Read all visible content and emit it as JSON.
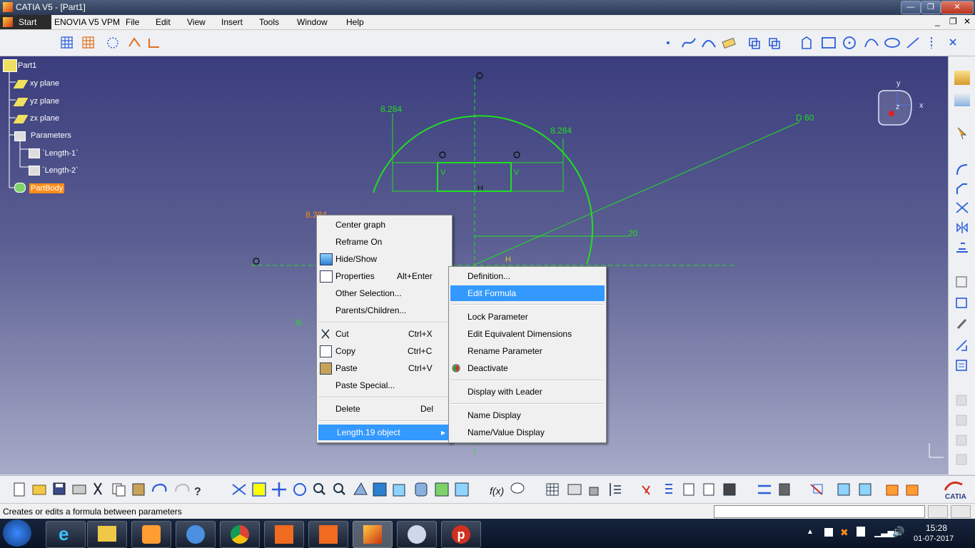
{
  "window": {
    "title": "CATIA V5 - [Part1]"
  },
  "menubar": {
    "items": [
      "Start",
      "ENOVIA V5 VPM",
      "File",
      "Edit",
      "View",
      "Insert",
      "Tools",
      "Window",
      "Help"
    ]
  },
  "tree": {
    "root": "Part1",
    "items": [
      "xy plane",
      "yz plane",
      "zx plane",
      "Parameters",
      "`Length-1`",
      "`Length-2`",
      "PartBody"
    ]
  },
  "sketch": {
    "dim_top_left": "8.284",
    "dim_top_right": "8.284",
    "dim_diameter": "D 60",
    "dim_left": "8.284",
    "dim_right": "20",
    "dim_partial": "8.",
    "label_v1": "V",
    "label_v2": "V",
    "label_h_top": "H",
    "label_h_mid": "H"
  },
  "axis": {
    "x": "x",
    "y": "y",
    "z": "z"
  },
  "context_menu": {
    "items": [
      {
        "label": "Center graph",
        "shortcut": ""
      },
      {
        "label": "Reframe On",
        "shortcut": ""
      },
      {
        "label": "Hide/Show",
        "shortcut": ""
      },
      {
        "label": "Properties",
        "shortcut": "Alt+Enter"
      },
      {
        "label": "Other Selection...",
        "shortcut": ""
      },
      {
        "label": "Parents/Children...",
        "shortcut": ""
      },
      {
        "label": "Cut",
        "shortcut": "Ctrl+X"
      },
      {
        "label": "Copy",
        "shortcut": "Ctrl+C"
      },
      {
        "label": "Paste",
        "shortcut": "Ctrl+V"
      },
      {
        "label": "Paste Special...",
        "shortcut": ""
      },
      {
        "label": "Delete",
        "shortcut": "Del"
      },
      {
        "label": "Length.19 object",
        "shortcut": ""
      }
    ]
  },
  "submenu": {
    "items": [
      "Definition...",
      "Edit Formula",
      "Lock Parameter",
      "Edit Equivalent Dimensions",
      "Rename Parameter",
      "Deactivate",
      "Display with Leader",
      "Name Display",
      "Name/Value Display"
    ]
  },
  "status": {
    "text": "Creates or edits a formula between parameters"
  },
  "taskbar": {
    "time": "15:28",
    "date": "01-07-2017"
  },
  "colors": {
    "highlight": "#3399ff",
    "sketch_green": "#22dd22",
    "tree_selected": "#ff8c1a"
  }
}
